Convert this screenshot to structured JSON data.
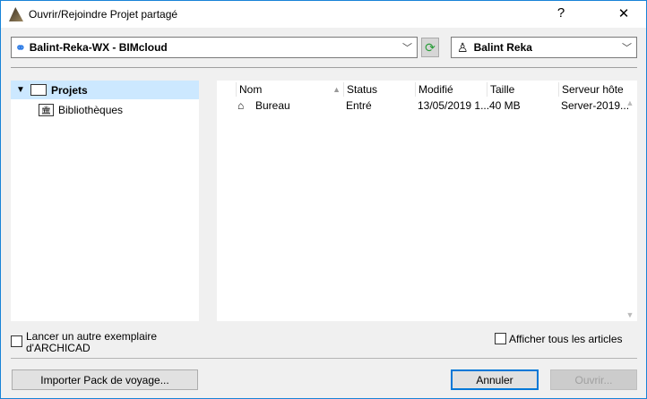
{
  "window": {
    "title": "Ouvrir/Rejoindre Projet partagé",
    "help_label": "?",
    "close_label": "✕"
  },
  "server_combo": {
    "value": "Balint-Reka-WX - BIMcloud"
  },
  "user_combo": {
    "value": "Balint Reka"
  },
  "tree": {
    "items": [
      {
        "label": "Projets",
        "selected": true
      },
      {
        "label": "Bibliothèques"
      }
    ]
  },
  "list": {
    "columns": [
      "Nom",
      "Status",
      "Modifié",
      "Taille",
      "Serveur hôte"
    ],
    "rows": [
      {
        "name": "Bureau",
        "status": "Entré",
        "modified": "13/05/2019 1...",
        "size": "40 MB",
        "host": "Server-2019..."
      }
    ]
  },
  "options": {
    "launch_other": "Lancer un autre exemplaire d'ARCHICAD",
    "show_all": "Afficher tous les articles"
  },
  "buttons": {
    "import": "Importer Pack de voyage...",
    "cancel": "Annuler",
    "open": "Ouvrir..."
  }
}
